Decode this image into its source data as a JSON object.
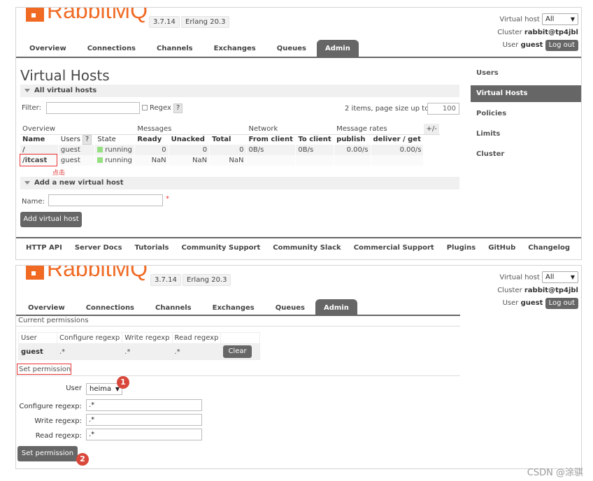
{
  "header": {
    "logo_word": "RabbitMQ",
    "version": "3.7.14",
    "erlang": "Erlang 20.3",
    "virtual_host_label": "Virtual host",
    "virtual_host_value": "All",
    "cluster_label": "Cluster",
    "cluster_value": "rabbit@tp4jbl",
    "user_label": "User",
    "user_value": "guest",
    "logout_label": "Log out"
  },
  "tabs": [
    "Overview",
    "Connections",
    "Channels",
    "Exchanges",
    "Queues",
    "Admin"
  ],
  "active_tab": "Admin",
  "sidebar": {
    "items": [
      {
        "label": "Users"
      },
      {
        "label": "Virtual Hosts",
        "active": true
      },
      {
        "label": "Policies"
      },
      {
        "label": "Limits"
      },
      {
        "label": "Cluster"
      }
    ]
  },
  "vhosts_page": {
    "title": "Virtual Hosts",
    "all_section": "All virtual hosts",
    "filter_label": "Filter:",
    "regex_label": "Regex",
    "help": "?",
    "pagination_text": "2 items, page size up to",
    "page_size": "100",
    "groups": [
      "Overview",
      "Messages",
      "Network",
      "Message rates",
      "+/-"
    ],
    "columns": [
      "Name",
      "Users",
      "State",
      "Ready",
      "Unacked",
      "Total",
      "From client",
      "To client",
      "publish",
      "deliver / get"
    ],
    "rows": [
      {
        "name": "/",
        "users": "guest",
        "state": "running",
        "ready": "0",
        "unacked": "0",
        "total": "0",
        "from_client": "0B/s",
        "to_client": "0B/s",
        "publish": "0.00/s",
        "deliver": "0.00/s"
      },
      {
        "name": "/itcast",
        "users": "guest",
        "state": "running",
        "ready": "NaN",
        "unacked": "NaN",
        "total": "NaN",
        "from_client": "",
        "to_client": "",
        "publish": "",
        "deliver": ""
      }
    ],
    "click_note": "点击",
    "add_section": "Add a new virtual host",
    "name_label": "Name:",
    "required_mark": "*",
    "add_button": "Add virtual host"
  },
  "footer": [
    "HTTP API",
    "Server Docs",
    "Tutorials",
    "Community Support",
    "Community Slack",
    "Commercial Support",
    "Plugins",
    "GitHub",
    "Changelog"
  ],
  "permissions_page": {
    "current_title": "Current permissions",
    "columns": [
      "User",
      "Configure regexp",
      "Write regexp",
      "Read regexp"
    ],
    "row": {
      "user": "guest",
      "configure": ".*",
      "write": ".*",
      "read": ".*"
    },
    "clear_button": "Clear",
    "set_title": "Set permission",
    "user_label": "User",
    "user_value": "heima",
    "configure_label": "Configure regexp:",
    "configure_value": ".*",
    "write_label": "Write regexp:",
    "write_value": ".*",
    "read_label": "Read regexp:",
    "read_value": ".*",
    "submit_button": "Set permission",
    "badge1": "1",
    "badge2": "2"
  },
  "watermark": "CSDN @涂骐",
  "colors": {
    "brand": "#f06a24",
    "dark": "#666666",
    "running": "#96e082",
    "annotation": "#e33333"
  }
}
